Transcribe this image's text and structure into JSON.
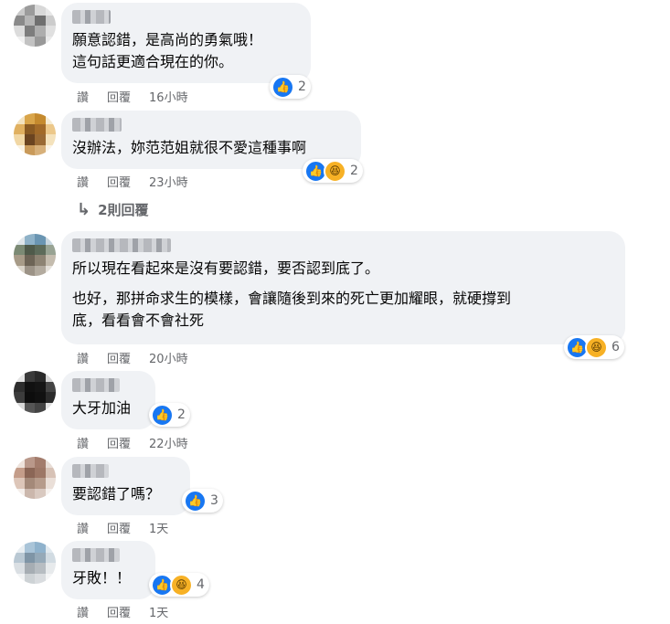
{
  "comments": [
    {
      "lines": [
        "願意認錯，是高尚的勇氣哦！\n這句話更適合現在的你。"
      ],
      "reaction_count": "2",
      "reactions": [
        "like"
      ],
      "actions": {
        "like": "讚",
        "reply": "回覆",
        "time": "16小時"
      }
    },
    {
      "lines": [
        "沒辦法，妳范范姐就很不愛這種事啊"
      ],
      "reaction_count": "2",
      "reactions": [
        "like",
        "haha"
      ],
      "actions": {
        "like": "讚",
        "reply": "回覆",
        "time": "23小時"
      }
    },
    {
      "lines": [
        "所以現在看起來是沒有要認錯，要否認到底了。",
        "也好，那拼命求生的模樣，會讓隨後到來的死亡更加耀眼，就硬撐到\n底，看看會不會社死"
      ],
      "reaction_count": "6",
      "reactions": [
        "like",
        "haha"
      ],
      "actions": {
        "like": "讚",
        "reply": "回覆",
        "time": "20小時"
      }
    },
    {
      "lines": [
        "大牙加油"
      ],
      "reaction_count": "2",
      "reactions": [
        "like"
      ],
      "actions": {
        "like": "讚",
        "reply": "回覆",
        "time": "22小時"
      }
    },
    {
      "lines": [
        "要認錯了嗎？"
      ],
      "reaction_count": "3",
      "reactions": [
        "like"
      ],
      "actions": {
        "like": "讚",
        "reply": "回覆",
        "time": "1天"
      }
    },
    {
      "lines": [
        "牙敗！！"
      ],
      "reaction_count": "4",
      "reactions": [
        "like",
        "haha"
      ],
      "actions": {
        "like": "讚",
        "reply": "回覆",
        "time": "1天"
      }
    }
  ],
  "view_replies": {
    "label": "2則回覆"
  },
  "colors": {
    "bubble": "#f0f2f5",
    "like": "#1877f2",
    "haha": "#f7b125",
    "meta": "#65676b"
  },
  "icons": {
    "like": "thumbs-up-icon",
    "haha": "laughing-face-icon",
    "reply_arrow": "reply-arrow-icon"
  }
}
